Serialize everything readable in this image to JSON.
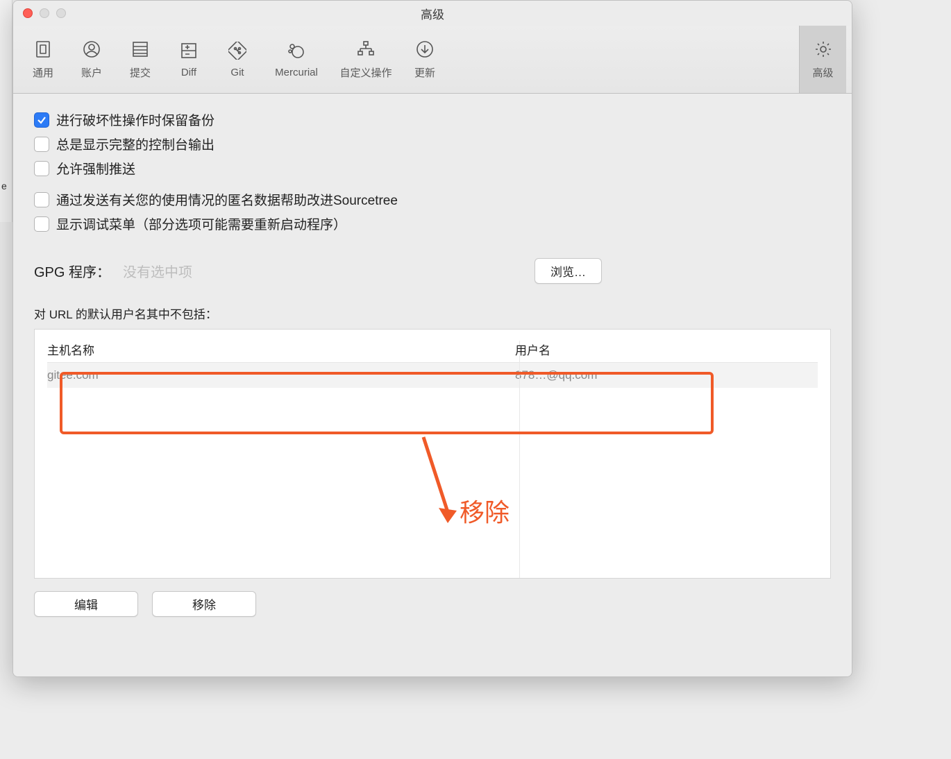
{
  "window": {
    "title": "高级"
  },
  "toolbar": {
    "general": "通用",
    "accounts": "账户",
    "commit": "提交",
    "diff": "Diff",
    "git": "Git",
    "mercurial": "Mercurial",
    "custom_actions": "自定义操作",
    "updates": "更新",
    "advanced": "高级"
  },
  "checks": {
    "keep_backup": "进行破坏性操作时保留备份",
    "full_console": "总是显示完整的控制台输出",
    "force_push": "允许强制推送",
    "anon_data": "通过发送有关您的使用情况的匿名数据帮助改进Sourcetree",
    "debug_menu": "显示调试菜单（部分选项可能需要重新启动程序）"
  },
  "gpg": {
    "label": "GPG 程序：",
    "value": "没有选中项",
    "browse": "浏览…"
  },
  "url_section": {
    "label": "对 URL 的默认用户名其中不包括：",
    "col_host": "主机名称",
    "col_user": "用户名",
    "rows": [
      {
        "host": "gitee.com",
        "user": "878…@qq.com"
      }
    ]
  },
  "buttons": {
    "edit": "编辑",
    "remove": "移除"
  },
  "annotation": {
    "text": "移除"
  },
  "left_edge_char": "e"
}
